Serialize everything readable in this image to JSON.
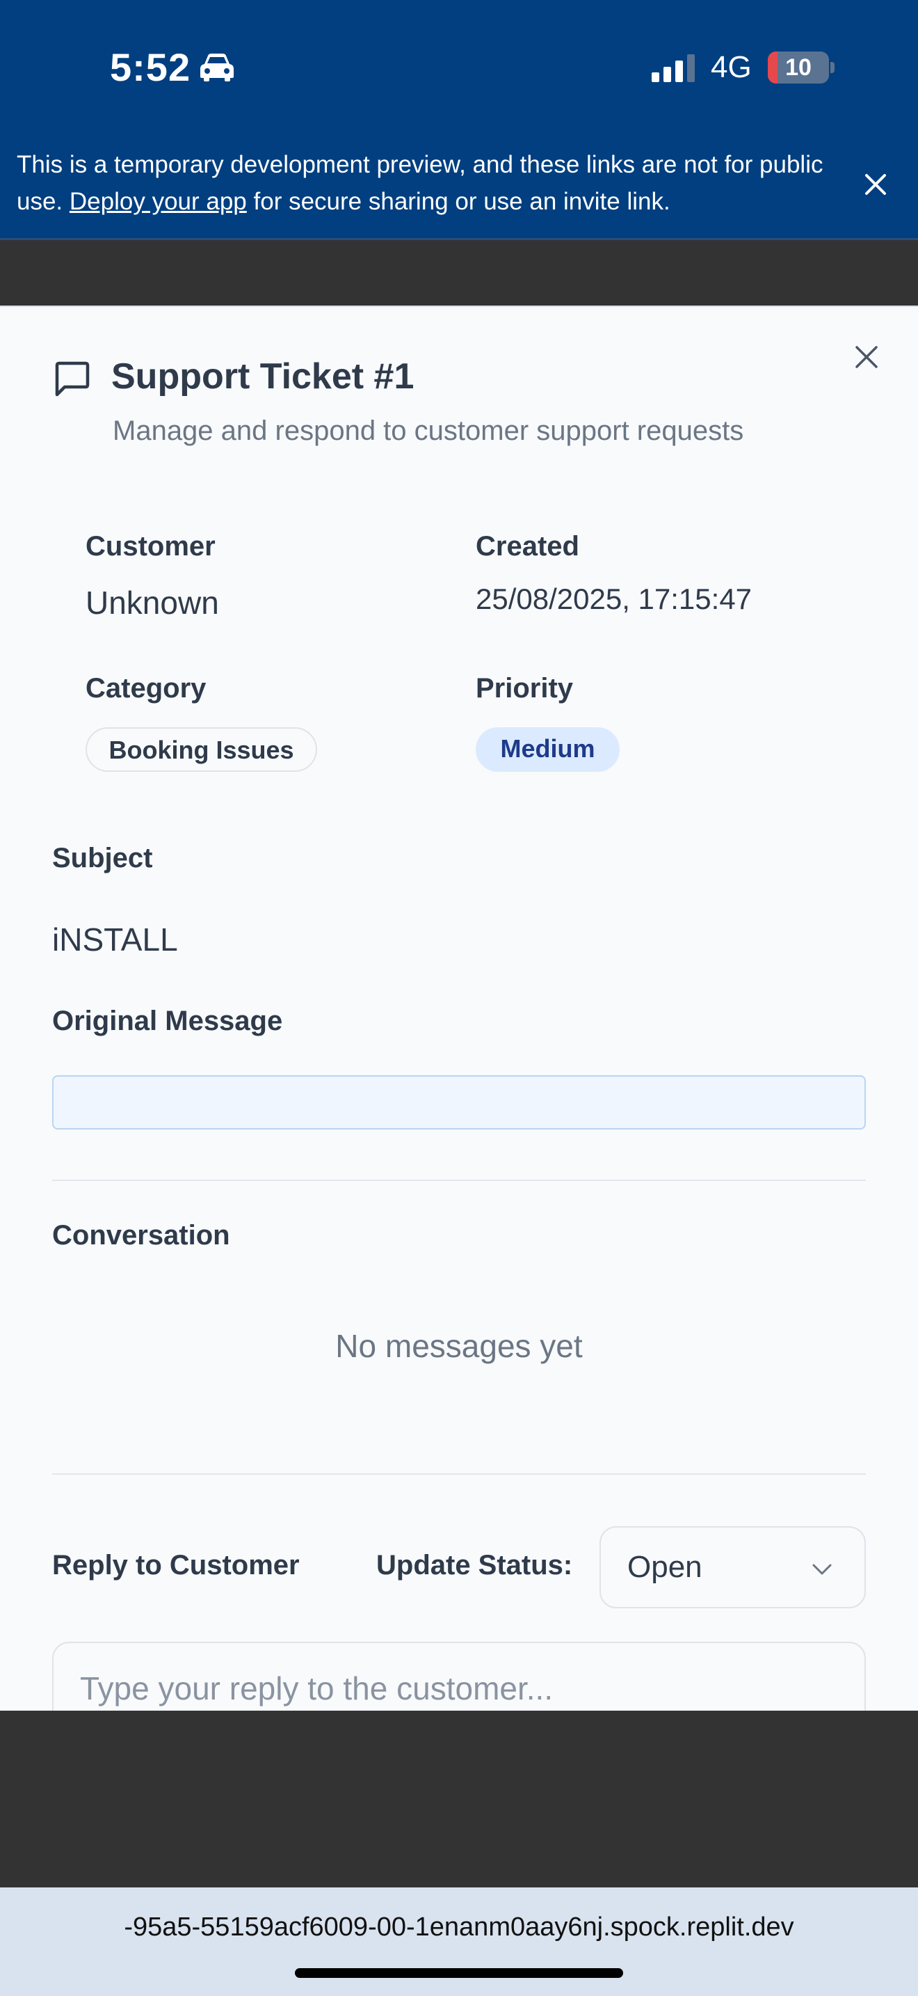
{
  "status_bar": {
    "time": "5:52",
    "network": "4G",
    "battery": "10",
    "battery_low_color": "#e5484d"
  },
  "banner": {
    "text_before": "This is a temporary development preview, and these links are not for public use. ",
    "link": "Deploy your app",
    "text_after": " for secure sharing or use an invite link.",
    "background": "#013f80"
  },
  "ticket": {
    "title": "Support Ticket #1",
    "subtitle": "Manage and respond to customer support requests",
    "customer_label": "Customer",
    "customer_value": "Unknown",
    "created_label": "Created",
    "created_value": "25/08/2025, 17:15:47",
    "category_label": "Category",
    "category_value": "Booking Issues",
    "priority_label": "Priority",
    "priority_value": "Medium",
    "subject_label": "Subject",
    "subject_value": "iNSTALL",
    "original_message_label": "Original Message",
    "original_message_value": "",
    "conversation_label": "Conversation",
    "conversation_empty": "No messages yet",
    "reply_label": "Reply to Customer",
    "update_status_label": "Update Status:",
    "status_value": "Open",
    "reply_placeholder": "Type your reply to the customer..."
  },
  "browser": {
    "url": "-95a5-55159acf6009-00-1enanm0aay6nj.spock.replit.dev"
  },
  "icons": {
    "car": "car-icon",
    "signal": "cellular-signal-icon",
    "battery": "battery-icon",
    "banner_close": "close-icon",
    "title": "message-square-icon",
    "modal_close": "close-icon",
    "select": "chevron-down-icon"
  }
}
